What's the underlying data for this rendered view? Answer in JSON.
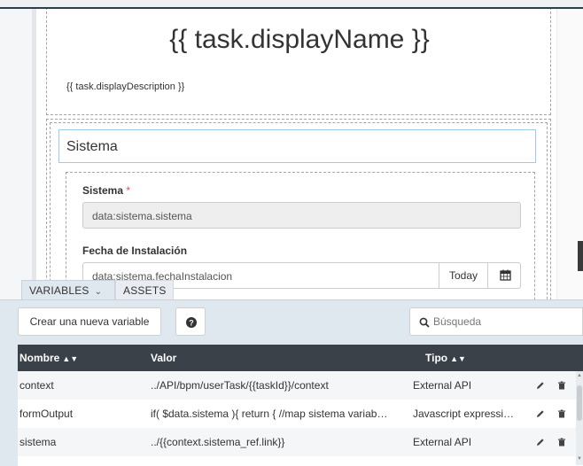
{
  "form": {
    "display_name": "{{ task.displayName }}",
    "display_description": "{{ task.displayDescription }}",
    "section_title": "Sistema",
    "fields": {
      "sistema_label": "Sistema",
      "required_mark": "*",
      "sistema_value": "data:sistema.sistema",
      "fecha_label": "Fecha de Instalación",
      "fecha_value": "data:sistema.fechaInstalacion",
      "today_label": "Today"
    }
  },
  "tabs": [
    {
      "label": "VARIABLES",
      "icon": "chevron-down-icon",
      "active": true
    },
    {
      "label": "ASSETS",
      "active": false
    }
  ],
  "toolbar": {
    "new_variable_label": "Crear una nueva variable",
    "help_icon": "question-circle-icon",
    "search_placeholder": "Búsqueda",
    "search_icon": "search-icon"
  },
  "table": {
    "columns": [
      "Nombre",
      "Valor",
      "Tipo"
    ],
    "sortable": [
      true,
      false,
      true
    ],
    "rows": [
      {
        "name": "context",
        "value": "../API/bpm/userTask/{{taskId}}/context",
        "type": "External API"
      },
      {
        "name": "formOutput",
        "value": "if( $data.sistema ){ return { //map sistema variab…",
        "type": "Javascript expressi…"
      },
      {
        "name": "sistema",
        "value": "../{{context.sistema_ref.link}}",
        "type": "External API"
      }
    ],
    "row_action_icons": [
      "pencil-icon",
      "trash-icon"
    ]
  },
  "colors": {
    "panel_bg": "#dfe7ef",
    "table_header_bg": "#3a4149",
    "section_border": "#9ecbe8",
    "required": "#d9534f"
  }
}
